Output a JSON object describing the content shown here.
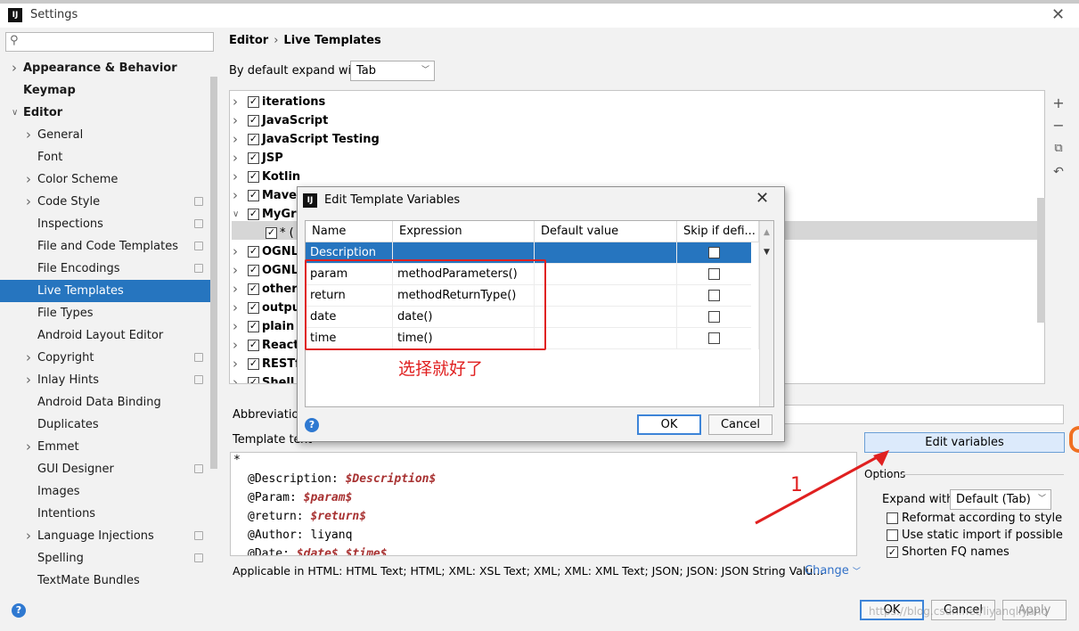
{
  "window": {
    "title": "Settings"
  },
  "search": {
    "placeholder": ""
  },
  "nav": [
    {
      "label": "Appearance & Behavior",
      "level": 0,
      "arrow": "right",
      "bold": true
    },
    {
      "label": "Keymap",
      "level": 0,
      "arrow": "",
      "bold": true
    },
    {
      "label": "Editor",
      "level": 0,
      "arrow": "down",
      "bold": true
    },
    {
      "label": "General",
      "level": 1,
      "arrow": "right"
    },
    {
      "label": "Font",
      "level": 1,
      "arrow": ""
    },
    {
      "label": "Color Scheme",
      "level": 1,
      "arrow": "right"
    },
    {
      "label": "Code Style",
      "level": 1,
      "arrow": "right",
      "ext": true
    },
    {
      "label": "Inspections",
      "level": 1,
      "arrow": "",
      "ext": true
    },
    {
      "label": "File and Code Templates",
      "level": 1,
      "arrow": "",
      "ext": true
    },
    {
      "label": "File Encodings",
      "level": 1,
      "arrow": "",
      "ext": true
    },
    {
      "label": "Live Templates",
      "level": 1,
      "arrow": "",
      "selected": true
    },
    {
      "label": "File Types",
      "level": 1,
      "arrow": ""
    },
    {
      "label": "Android Layout Editor",
      "level": 1,
      "arrow": ""
    },
    {
      "label": "Copyright",
      "level": 1,
      "arrow": "right",
      "ext": true
    },
    {
      "label": "Inlay Hints",
      "level": 1,
      "arrow": "right",
      "ext": true
    },
    {
      "label": "Android Data Binding",
      "level": 1,
      "arrow": ""
    },
    {
      "label": "Duplicates",
      "level": 1,
      "arrow": ""
    },
    {
      "label": "Emmet",
      "level": 1,
      "arrow": "right"
    },
    {
      "label": "GUI Designer",
      "level": 1,
      "arrow": "",
      "ext": true
    },
    {
      "label": "Images",
      "level": 1,
      "arrow": ""
    },
    {
      "label": "Intentions",
      "level": 1,
      "arrow": ""
    },
    {
      "label": "Language Injections",
      "level": 1,
      "arrow": "right",
      "ext": true
    },
    {
      "label": "Spelling",
      "level": 1,
      "arrow": "",
      "ext": true
    },
    {
      "label": "TextMate Bundles",
      "level": 1,
      "arrow": ""
    }
  ],
  "breadcrumb": {
    "first": "Editor",
    "second": "Live Templates"
  },
  "expand_default": {
    "label": "By default expand with",
    "value": "Tab"
  },
  "template_groups": [
    {
      "label": "iterations",
      "expanded": false
    },
    {
      "label": "JavaScript",
      "expanded": false
    },
    {
      "label": "JavaScript Testing",
      "expanded": false
    },
    {
      "label": "JSP",
      "expanded": false
    },
    {
      "label": "Kotlin",
      "expanded": false
    },
    {
      "label": "Maven",
      "expanded": false
    },
    {
      "label": "MyGr",
      "expanded": true
    },
    {
      "label": "* (",
      "expanded": false,
      "child": true
    },
    {
      "label": "OGNL",
      "expanded": false
    },
    {
      "label": "OGNL",
      "expanded": false
    },
    {
      "label": "other",
      "expanded": false
    },
    {
      "label": "outpu",
      "expanded": false
    },
    {
      "label": "plain",
      "expanded": false
    },
    {
      "label": "React",
      "expanded": false
    },
    {
      "label": "RESTf",
      "expanded": false
    },
    {
      "label": "Shell",
      "expanded": false
    }
  ],
  "abbreviation": {
    "label": "Abbreviatio"
  },
  "template_text": {
    "label": "Template text",
    "lines": [
      {
        "pre": "*",
        "var": "",
        "indent": false
      },
      {
        "pre": "@Description: ",
        "var": "$Description$",
        "indent": true
      },
      {
        "pre": "@Param: ",
        "var": "$param$",
        "indent": true
      },
      {
        "pre": "@return: ",
        "var": "$return$",
        "indent": true
      },
      {
        "pre": "@Author: liyanq",
        "var": "",
        "indent": true
      },
      {
        "pre": "@Date: ",
        "var": "$date$ $time$",
        "indent": true
      }
    ]
  },
  "edit_variables_button": "Edit variables",
  "options": {
    "title": "Options",
    "expand_with_label": "Expand with",
    "expand_with_value": "Default (Tab)",
    "reformat": "Reformat according to style",
    "static_import": "Use static import if possible",
    "shorten_fq": "Shorten FQ names",
    "reformat_checked": false,
    "static_import_checked": false,
    "shorten_fq_checked": true
  },
  "applicable": "Applicable in HTML: HTML Text; HTML; XML: XSL Text; XML; XML: XML Text; JSON; JSON: JSON String Valu...",
  "change_link": "Change",
  "footer": {
    "ok": "OK",
    "cancel": "Cancel",
    "apply": "Apply"
  },
  "watermark": "https://blog.csdn.net/liyanqliyanq",
  "dialog": {
    "title": "Edit Template Variables",
    "columns": [
      "Name",
      "Expression",
      "Default value",
      "Skip if defi..."
    ],
    "rows": [
      {
        "name": "Description",
        "expression": "",
        "default": "",
        "skip": false,
        "selected": true
      },
      {
        "name": "param",
        "expression": "methodParameters()",
        "default": "",
        "skip": false
      },
      {
        "name": "return",
        "expression": "methodReturnType()",
        "default": "",
        "skip": false
      },
      {
        "name": "date",
        "expression": "date()",
        "default": "",
        "skip": false
      },
      {
        "name": "time",
        "expression": "time()",
        "default": "",
        "skip": false
      }
    ],
    "ok": "OK",
    "cancel": "Cancel"
  },
  "annotations": {
    "hint": "选择就好了",
    "step": "1",
    "color": "#e02020"
  }
}
